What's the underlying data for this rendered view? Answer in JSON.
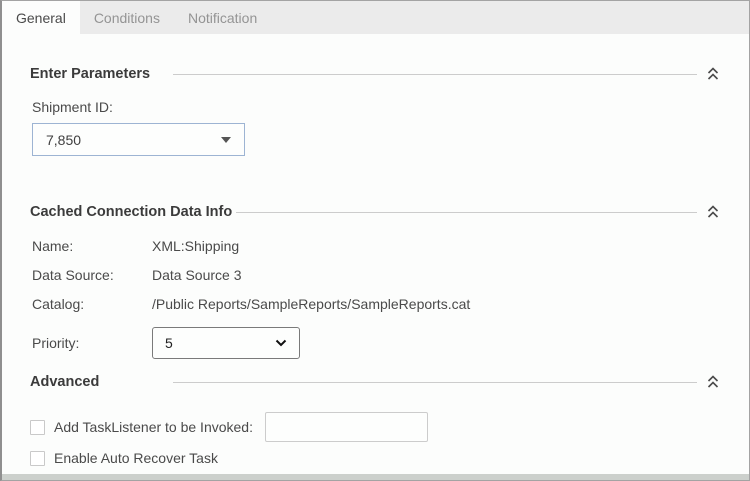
{
  "tabs": [
    {
      "label": "General",
      "active": true
    },
    {
      "label": "Conditions",
      "active": false
    },
    {
      "label": "Notification",
      "active": false
    }
  ],
  "parameters": {
    "title": "Enter Parameters",
    "shipment_label": "Shipment ID:",
    "shipment_value": "7,850"
  },
  "cache_info": {
    "title": "Cached Connection Data Info",
    "rows": [
      {
        "label": "Name:",
        "value": "XML:Shipping"
      },
      {
        "label": "Data Source:",
        "value": "Data Source 3"
      },
      {
        "label": "Catalog:",
        "value": "/Public Reports/SampleReports/SampleReports.cat"
      }
    ],
    "priority_label": "Priority:",
    "priority_value": "5"
  },
  "advanced": {
    "title": "Advanced",
    "tasklistener_label": "Add TaskListener to be Invoked:",
    "tasklistener_value": "",
    "autorecover_label": "Enable Auto Recover Task"
  },
  "colors": {
    "tab_strip": "#ebebeb",
    "content_bg": "#fcfdfc",
    "combobox_border": "#9db4d3",
    "divider": "#cccccc",
    "text": "#4a4a4a",
    "inactive_tab_text": "#949494",
    "select_border": "#7a7a7a",
    "bottom_strip": "#ccd0cc"
  }
}
